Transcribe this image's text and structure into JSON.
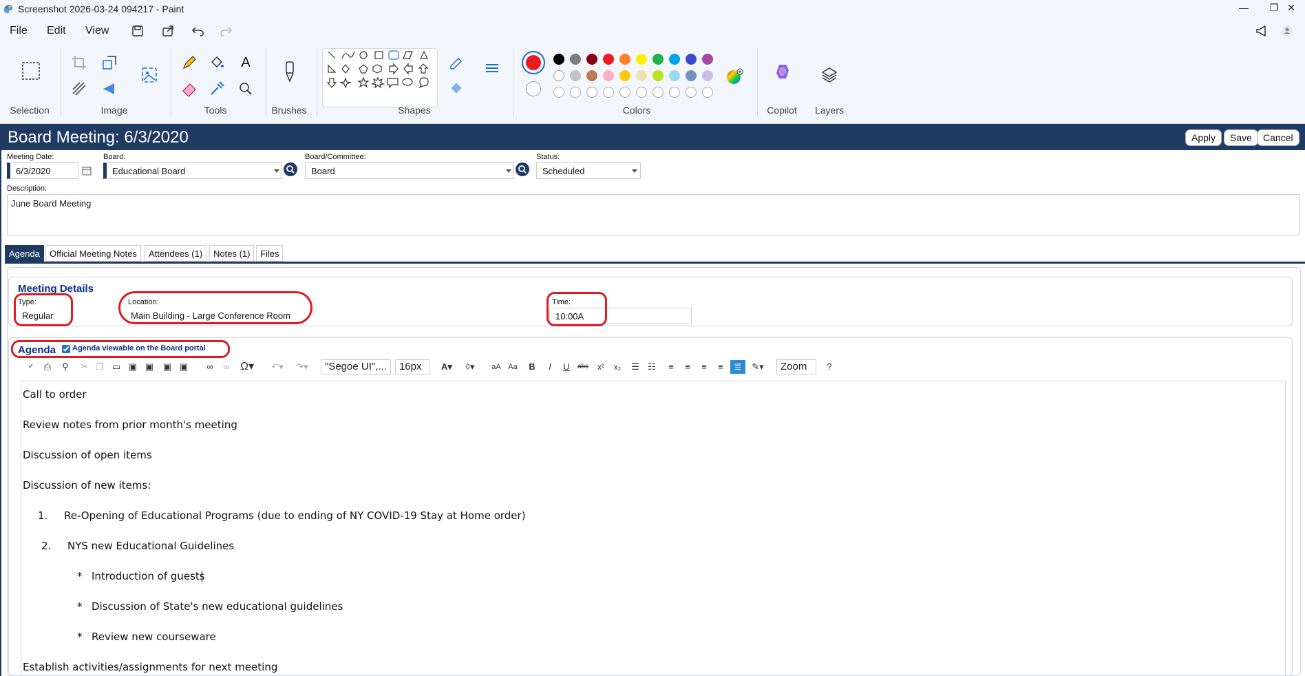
{
  "window": {
    "title": "Screenshot 2026-03-24 094217 - Paint",
    "minimize": "—",
    "maximize": "❐",
    "close": "✕"
  },
  "menubar": {
    "file": "File",
    "edit": "Edit",
    "view": "View"
  },
  "ribbon": {
    "groups": {
      "selection": "Selection",
      "image": "Image",
      "tools": "Tools",
      "brushes": "Brushes",
      "shapes": "Shapes",
      "colors": "Colors",
      "copilot": "Copilot",
      "layers": "Layers"
    },
    "primary_color": "#e81c24",
    "palette_row1": [
      "#000000",
      "#7f7f7f",
      "#880015",
      "#ed1c24",
      "#ff7f27",
      "#fff200",
      "#22b14c",
      "#00a2e8",
      "#3f48cc",
      "#a349a4"
    ],
    "palette_row2": [
      "#ffffff",
      "#c3c3c3",
      "#b97a57",
      "#ffaec9",
      "#ffc90e",
      "#efe4b0",
      "#b5e61d",
      "#99d9ea",
      "#7092be",
      "#c8bfe7"
    ]
  },
  "page": {
    "title": "Board Meeting: 6/3/2020",
    "buttons": {
      "apply": "Apply",
      "save": "Save",
      "cancel": "Cancel"
    }
  },
  "form": {
    "meeting_date": {
      "label": "Meeting Date:",
      "value": "6/3/2020"
    },
    "board": {
      "label": "Board:",
      "value": "Educational Board"
    },
    "committee": {
      "label": "Board/Committee:",
      "value": "Board"
    },
    "status": {
      "label": "Status:",
      "value": "Scheduled"
    },
    "description": {
      "label": "Description:",
      "value": "June Board Meeting"
    }
  },
  "tabs": [
    "Agenda",
    "Official Meeting Notes",
    "Attendees (1)",
    "Notes (1)",
    "Files"
  ],
  "meeting_details": {
    "heading": "Meeting Details",
    "type": {
      "label": "Type:",
      "value": "Regular"
    },
    "location": {
      "label": "Location:",
      "value": "Main Building - Large Conference Room"
    },
    "time": {
      "label": "Time:",
      "value": "10:00A"
    }
  },
  "agenda": {
    "heading": "Agenda",
    "portal_checkbox": {
      "label": "Agenda viewable on the Board portal",
      "checked": true
    },
    "toolbar": {
      "font": "\"Segoe UI\",...",
      "size": "16px",
      "zoom": "Zoom"
    },
    "content": [
      "Call to order",
      "Review notes from prior month's meeting",
      "Discussion of open items",
      "Discussion of new items:",
      "1.",
      "Re-Opening of Educational Programs (due to ending of NY COVID-19 Stay at Home order)",
      "2.",
      "NYS new Educational Guidelines",
      "*",
      "Introduction of guests",
      "*",
      "Discussion of State's new educational guidelines",
      "*",
      "Review new courseware",
      "Establish activities/assignments for next meeting"
    ]
  }
}
